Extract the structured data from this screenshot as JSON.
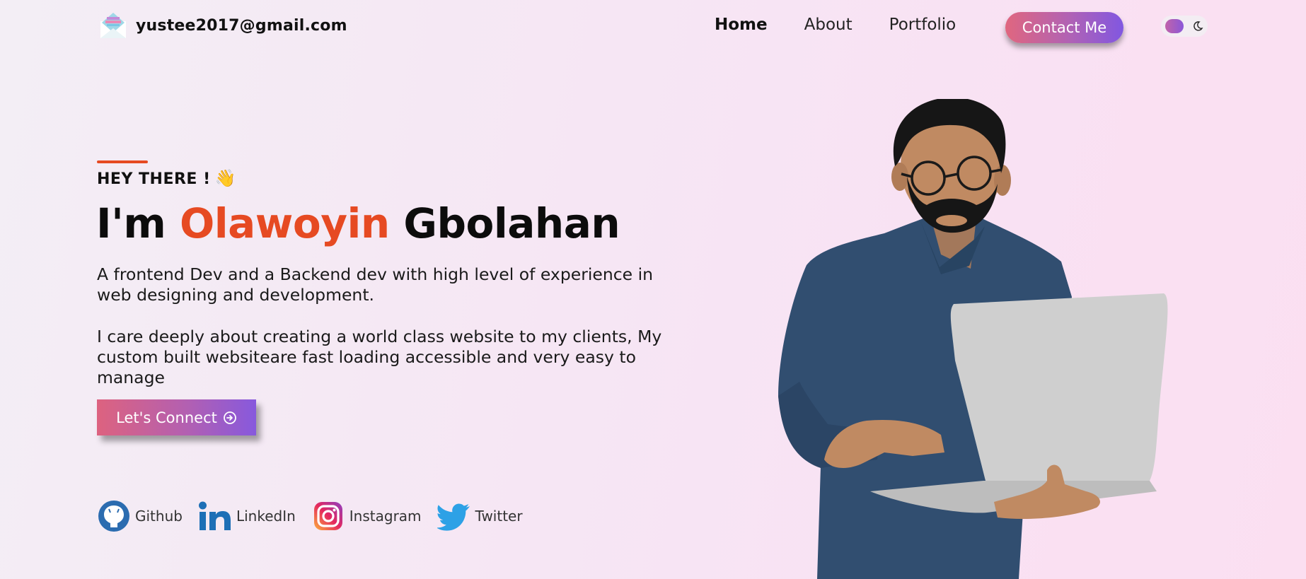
{
  "nav": {
    "brand_email": "yustee2017@gmail.com",
    "links": [
      "Home",
      "About",
      "Portfolio"
    ],
    "active_link": "Home",
    "contact_label": "Contact Me"
  },
  "hero": {
    "greeting": "HEY THERE !",
    "greeting_emoji": "👋",
    "headline_prefix": "I'm",
    "headline_accent": "Olawoyin",
    "headline_suffix": "Gbolahan",
    "paragraph_1": "A frontend Dev and a Backend dev with high level of experience in web designing and development.",
    "paragraph_2": "I care deeply about creating a world class website to my clients, My custom built websiteare fast loading accessible and very easy to manage",
    "cta_label": "Let's Connect"
  },
  "socials": [
    {
      "label": "Github",
      "icon": "github-icon"
    },
    {
      "label": "LinkedIn",
      "icon": "linkedin-icon"
    },
    {
      "label": "Instagram",
      "icon": "instagram-icon"
    },
    {
      "label": "Twitter",
      "icon": "twitter-icon"
    }
  ],
  "colors": {
    "accent": "#e64a22",
    "gradient_start": "#e0667f",
    "gradient_end": "#8157e1"
  }
}
